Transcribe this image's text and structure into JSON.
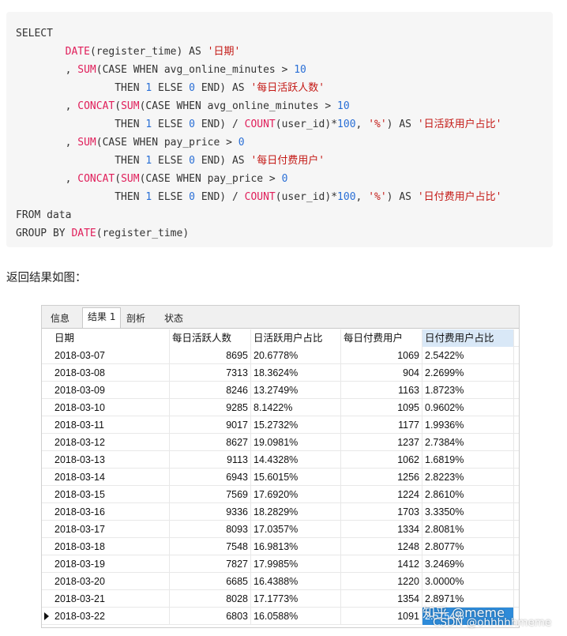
{
  "code": {
    "line1": "SELECT",
    "line2_indent": "        ",
    "line2_fn": "DATE",
    "line2_rest": "(register_time) AS ",
    "line2_str": "'日期'",
    "line3_prefix": "        , ",
    "line3_fn": "SUM",
    "line3_rest": "(CASE WHEN avg_online_minutes > ",
    "line3_num": "10",
    "line4_indent": "                THEN ",
    "line4_num1": "1",
    "line4_mid": " ELSE ",
    "line4_num2": "0",
    "line4_rest": " END) AS ",
    "line4_str": "'每日活跃人数'",
    "line5_prefix": "        , ",
    "line5_fn1": "CONCAT",
    "line5_paren": "(",
    "line5_fn2": "SUM",
    "line5_rest": "(CASE WHEN avg_online_minutes > ",
    "line5_num": "10",
    "line6_indent": "                THEN ",
    "line6_num1": "1",
    "line6_mid": " ELSE ",
    "line6_num2": "0",
    "line6_rest1": " END) / ",
    "line6_fn": "COUNT",
    "line6_rest2": "(user_id)*",
    "line6_num3": "100",
    "line6_rest3": ", ",
    "line6_str1": "'%'",
    "line6_rest4": ") AS ",
    "line6_str2": "'日活跃用户占比'",
    "line7_prefix": "        , ",
    "line7_fn": "SUM",
    "line7_rest": "(CASE WHEN pay_price > ",
    "line7_num": "0",
    "line8_indent": "                THEN ",
    "line8_num1": "1",
    "line8_mid": " ELSE ",
    "line8_num2": "0",
    "line8_rest": " END) AS ",
    "line8_str": "'每日付费用户'",
    "line9_prefix": "        , ",
    "line9_fn1": "CONCAT",
    "line9_paren": "(",
    "line9_fn2": "SUM",
    "line9_rest": "(CASE WHEN pay_price > ",
    "line9_num": "0",
    "line10_indent": "                THEN ",
    "line10_num1": "1",
    "line10_mid": " ELSE ",
    "line10_num2": "0",
    "line10_rest1": " END) / ",
    "line10_fn": "COUNT",
    "line10_rest2": "(user_id)*",
    "line10_num3": "100",
    "line10_rest3": ", ",
    "line10_str1": "'%'",
    "line10_rest4": ") AS ",
    "line10_str2": "'日付费用户占比'",
    "line11": "FROM data",
    "line12_kw": "GROUP BY ",
    "line12_fn": "DATE",
    "line12_rest": "(register_time)"
  },
  "caption": "返回结果如图：",
  "tabs": [
    "信息",
    "结果 1",
    "剖析",
    "状态"
  ],
  "active_tab": "结果 1",
  "columns": [
    "日期",
    "每日活跃人数",
    "日活跃用户占比",
    "每日付费用户",
    "日付费用户占比"
  ],
  "rows": [
    [
      "2018-03-07",
      "8695",
      "20.6778%",
      "1069",
      "2.5422%"
    ],
    [
      "2018-03-08",
      "7313",
      "18.3624%",
      "904",
      "2.2699%"
    ],
    [
      "2018-03-09",
      "8246",
      "13.2749%",
      "1163",
      "1.8723%"
    ],
    [
      "2018-03-10",
      "9285",
      "8.1422%",
      "1095",
      "0.9602%"
    ],
    [
      "2018-03-11",
      "9017",
      "15.2732%",
      "1177",
      "1.9936%"
    ],
    [
      "2018-03-12",
      "8627",
      "19.0981%",
      "1237",
      "2.7384%"
    ],
    [
      "2018-03-13",
      "9113",
      "14.4328%",
      "1062",
      "1.6819%"
    ],
    [
      "2018-03-14",
      "6943",
      "15.6015%",
      "1256",
      "2.8223%"
    ],
    [
      "2018-03-15",
      "7569",
      "17.6920%",
      "1224",
      "2.8610%"
    ],
    [
      "2018-03-16",
      "9336",
      "18.2829%",
      "1703",
      "3.3350%"
    ],
    [
      "2018-03-17",
      "8093",
      "17.0357%",
      "1334",
      "2.8081%"
    ],
    [
      "2018-03-18",
      "7548",
      "16.9813%",
      "1248",
      "2.8077%"
    ],
    [
      "2018-03-19",
      "7827",
      "17.9985%",
      "1412",
      "3.2469%"
    ],
    [
      "2018-03-20",
      "6685",
      "16.4388%",
      "1220",
      "3.0000%"
    ],
    [
      "2018-03-21",
      "8028",
      "17.1773%",
      "1354",
      "2.8971%"
    ],
    [
      "2018-03-22",
      "6803",
      "16.0588%",
      "1091",
      "2.5754%"
    ]
  ],
  "selected_row_index": 15,
  "watermark": {
    "line1": "知乎 @meme",
    "line2": "CSDN @ohhhhhmeme"
  },
  "colors": {
    "code_bg": "#f6f6f6",
    "function": "#e01e5a",
    "number": "#2a6fd6",
    "string": "#c41a16",
    "selection": "#2e8bd9",
    "header_highlight": "#d9e8f7"
  }
}
